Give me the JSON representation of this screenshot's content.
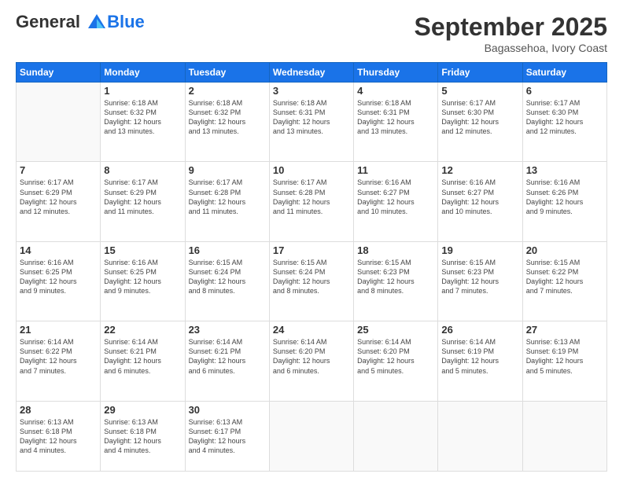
{
  "logo": {
    "line1": "General",
    "line2": "Blue"
  },
  "title": "September 2025",
  "subtitle": "Bagassehoa, Ivory Coast",
  "days_of_week": [
    "Sunday",
    "Monday",
    "Tuesday",
    "Wednesday",
    "Thursday",
    "Friday",
    "Saturday"
  ],
  "weeks": [
    [
      {
        "num": "",
        "info": ""
      },
      {
        "num": "1",
        "info": "Sunrise: 6:18 AM\nSunset: 6:32 PM\nDaylight: 12 hours\nand 13 minutes."
      },
      {
        "num": "2",
        "info": "Sunrise: 6:18 AM\nSunset: 6:32 PM\nDaylight: 12 hours\nand 13 minutes."
      },
      {
        "num": "3",
        "info": "Sunrise: 6:18 AM\nSunset: 6:31 PM\nDaylight: 12 hours\nand 13 minutes."
      },
      {
        "num": "4",
        "info": "Sunrise: 6:18 AM\nSunset: 6:31 PM\nDaylight: 12 hours\nand 13 minutes."
      },
      {
        "num": "5",
        "info": "Sunrise: 6:17 AM\nSunset: 6:30 PM\nDaylight: 12 hours\nand 12 minutes."
      },
      {
        "num": "6",
        "info": "Sunrise: 6:17 AM\nSunset: 6:30 PM\nDaylight: 12 hours\nand 12 minutes."
      }
    ],
    [
      {
        "num": "7",
        "info": "Sunrise: 6:17 AM\nSunset: 6:29 PM\nDaylight: 12 hours\nand 12 minutes."
      },
      {
        "num": "8",
        "info": "Sunrise: 6:17 AM\nSunset: 6:29 PM\nDaylight: 12 hours\nand 11 minutes."
      },
      {
        "num": "9",
        "info": "Sunrise: 6:17 AM\nSunset: 6:28 PM\nDaylight: 12 hours\nand 11 minutes."
      },
      {
        "num": "10",
        "info": "Sunrise: 6:17 AM\nSunset: 6:28 PM\nDaylight: 12 hours\nand 11 minutes."
      },
      {
        "num": "11",
        "info": "Sunrise: 6:16 AM\nSunset: 6:27 PM\nDaylight: 12 hours\nand 10 minutes."
      },
      {
        "num": "12",
        "info": "Sunrise: 6:16 AM\nSunset: 6:27 PM\nDaylight: 12 hours\nand 10 minutes."
      },
      {
        "num": "13",
        "info": "Sunrise: 6:16 AM\nSunset: 6:26 PM\nDaylight: 12 hours\nand 9 minutes."
      }
    ],
    [
      {
        "num": "14",
        "info": "Sunrise: 6:16 AM\nSunset: 6:25 PM\nDaylight: 12 hours\nand 9 minutes."
      },
      {
        "num": "15",
        "info": "Sunrise: 6:16 AM\nSunset: 6:25 PM\nDaylight: 12 hours\nand 9 minutes."
      },
      {
        "num": "16",
        "info": "Sunrise: 6:15 AM\nSunset: 6:24 PM\nDaylight: 12 hours\nand 8 minutes."
      },
      {
        "num": "17",
        "info": "Sunrise: 6:15 AM\nSunset: 6:24 PM\nDaylight: 12 hours\nand 8 minutes."
      },
      {
        "num": "18",
        "info": "Sunrise: 6:15 AM\nSunset: 6:23 PM\nDaylight: 12 hours\nand 8 minutes."
      },
      {
        "num": "19",
        "info": "Sunrise: 6:15 AM\nSunset: 6:23 PM\nDaylight: 12 hours\nand 7 minutes."
      },
      {
        "num": "20",
        "info": "Sunrise: 6:15 AM\nSunset: 6:22 PM\nDaylight: 12 hours\nand 7 minutes."
      }
    ],
    [
      {
        "num": "21",
        "info": "Sunrise: 6:14 AM\nSunset: 6:22 PM\nDaylight: 12 hours\nand 7 minutes."
      },
      {
        "num": "22",
        "info": "Sunrise: 6:14 AM\nSunset: 6:21 PM\nDaylight: 12 hours\nand 6 minutes."
      },
      {
        "num": "23",
        "info": "Sunrise: 6:14 AM\nSunset: 6:21 PM\nDaylight: 12 hours\nand 6 minutes."
      },
      {
        "num": "24",
        "info": "Sunrise: 6:14 AM\nSunset: 6:20 PM\nDaylight: 12 hours\nand 6 minutes."
      },
      {
        "num": "25",
        "info": "Sunrise: 6:14 AM\nSunset: 6:20 PM\nDaylight: 12 hours\nand 5 minutes."
      },
      {
        "num": "26",
        "info": "Sunrise: 6:14 AM\nSunset: 6:19 PM\nDaylight: 12 hours\nand 5 minutes."
      },
      {
        "num": "27",
        "info": "Sunrise: 6:13 AM\nSunset: 6:19 PM\nDaylight: 12 hours\nand 5 minutes."
      }
    ],
    [
      {
        "num": "28",
        "info": "Sunrise: 6:13 AM\nSunset: 6:18 PM\nDaylight: 12 hours\nand 4 minutes."
      },
      {
        "num": "29",
        "info": "Sunrise: 6:13 AM\nSunset: 6:18 PM\nDaylight: 12 hours\nand 4 minutes."
      },
      {
        "num": "30",
        "info": "Sunrise: 6:13 AM\nSunset: 6:17 PM\nDaylight: 12 hours\nand 4 minutes."
      },
      {
        "num": "",
        "info": ""
      },
      {
        "num": "",
        "info": ""
      },
      {
        "num": "",
        "info": ""
      },
      {
        "num": "",
        "info": ""
      }
    ]
  ]
}
